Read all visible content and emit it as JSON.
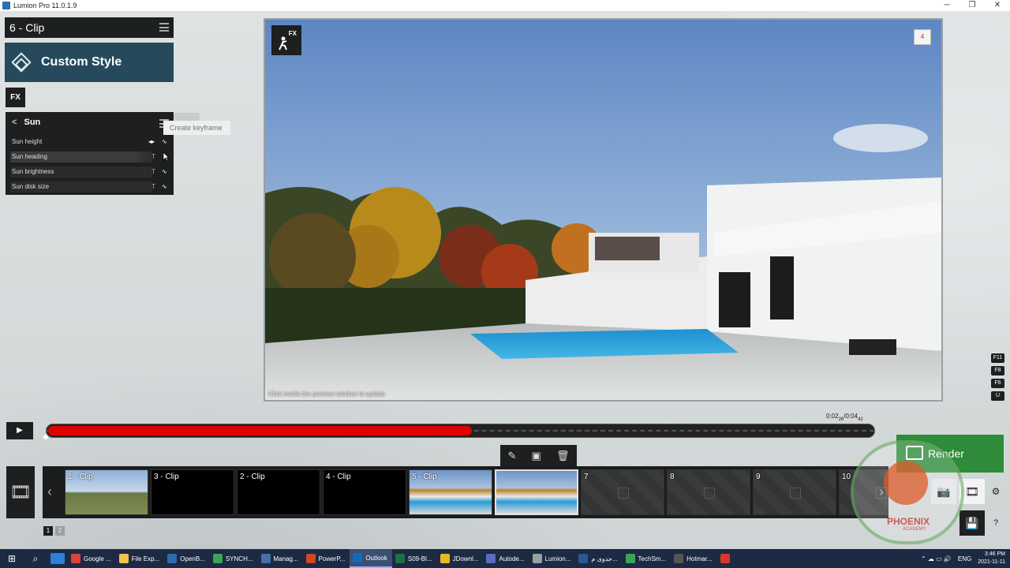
{
  "window": {
    "title": "Lumion Pro 11.0.1.9",
    "controls": [
      "─",
      "❐",
      "✕"
    ]
  },
  "left_panel": {
    "clip_title": "6 - Clip",
    "style_label": "Custom Style",
    "fx_label": "FX",
    "effect": {
      "title": "Sun",
      "rows": [
        {
          "label": "Sun height"
        },
        {
          "label": "Sun heading"
        },
        {
          "label": "Sun brightness"
        },
        {
          "label": "Sun disk size"
        }
      ],
      "tooltip": "Create keyframe"
    }
  },
  "preview": {
    "fx_badge": "FX",
    "rec_badge": "4",
    "hint": "Click inside the preview window to update"
  },
  "function_keys": [
    "F11",
    "F8",
    "F6",
    "U"
  ],
  "timeline": {
    "time_current": "0:02",
    "time_current_frames": "26",
    "time_total": "0:04",
    "time_total_frames": "42",
    "progress": 0.514,
    "render_label": "Render"
  },
  "clips": [
    {
      "label": "1 - Clip",
      "type": "field"
    },
    {
      "label": "3 - Clip",
      "type": "black"
    },
    {
      "label": "2 - Clip",
      "type": "black"
    },
    {
      "label": "4 - Clip",
      "type": "black"
    },
    {
      "label": "5 - Clip",
      "type": "house"
    },
    {
      "label": "",
      "type": "house",
      "selected": true
    },
    {
      "label": "7",
      "type": "empty"
    },
    {
      "label": "8",
      "type": "empty"
    },
    {
      "label": "9",
      "type": "empty"
    },
    {
      "label": "10",
      "type": "empty"
    }
  ],
  "pager": [
    "1",
    "2"
  ],
  "watermark": {
    "name": "PHOENIX",
    "sub": "ACADEMY"
  },
  "taskbar": {
    "items": [
      {
        "label": "Google ...",
        "color": "#db4437"
      },
      {
        "label": "File Exp...",
        "color": "#f2c14e"
      },
      {
        "label": "OpenB...",
        "color": "#2b6cb0"
      },
      {
        "label": "SYNCH...",
        "color": "#3aa655"
      },
      {
        "label": "Manag...",
        "color": "#4a6fa5"
      },
      {
        "label": "PowerP...",
        "color": "#d24726"
      },
      {
        "label": "Outlook",
        "color": "#0f6cbd",
        "active": true
      },
      {
        "label": "S09-Bl...",
        "color": "#1e7145"
      },
      {
        "label": "JDownl...",
        "color": "#e8b923"
      },
      {
        "label": "Autode...",
        "color": "#5c6bc0"
      },
      {
        "label": "Lumion...",
        "color": "#9aa0a2"
      },
      {
        "label": "جدوی م...",
        "color": "#2b579a"
      },
      {
        "label": "TechSm...",
        "color": "#3aa655"
      },
      {
        "label": "Hotmar...",
        "color": "#555"
      },
      {
        "label": "",
        "color": "#d9362b"
      }
    ],
    "lang": "ENG",
    "time": "3:46 PM",
    "date": "2021-11-11"
  }
}
